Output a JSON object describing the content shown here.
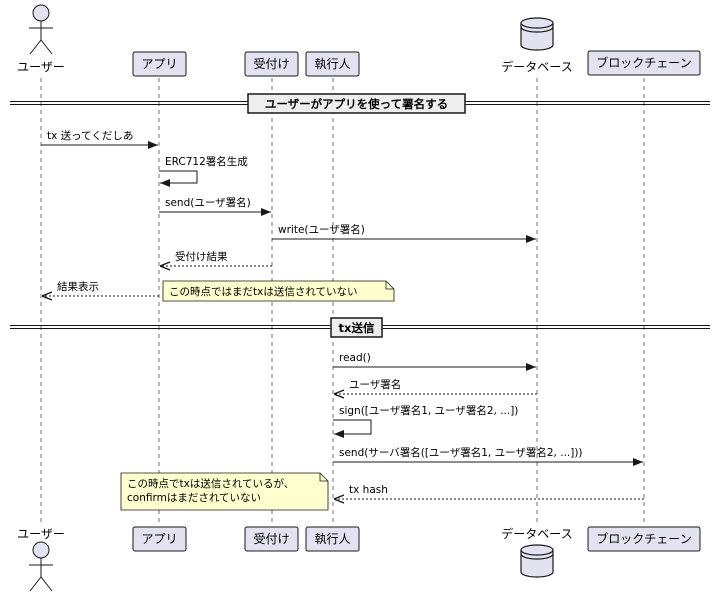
{
  "participants": [
    {
      "id": "user",
      "label": "ユーザー",
      "kind": "actor"
    },
    {
      "id": "app",
      "label": "アプリ",
      "kind": "box"
    },
    {
      "id": "recv",
      "label": "受付け",
      "kind": "box"
    },
    {
      "id": "exec",
      "label": "執行人",
      "kind": "box"
    },
    {
      "id": "db",
      "label": "データベース",
      "kind": "database"
    },
    {
      "id": "chain",
      "label": "ブロックチェーン",
      "kind": "box"
    }
  ],
  "sections": [
    {
      "title": "ユーザーがアプリを使って署名する"
    },
    {
      "title": "tx送信"
    }
  ],
  "messages": [
    {
      "from": "user",
      "to": "app",
      "label": "tx 送ってくだしあ",
      "style": "solid"
    },
    {
      "from": "app",
      "to": "app",
      "label": "ERC712署名生成",
      "style": "self"
    },
    {
      "from": "app",
      "to": "recv",
      "label": "send(ユーザ署名)",
      "style": "solid"
    },
    {
      "from": "recv",
      "to": "db",
      "label": "write(ユーザ署名)",
      "style": "solid"
    },
    {
      "from": "recv",
      "to": "app",
      "label": "受付け結果",
      "style": "dashed"
    },
    {
      "from": "app",
      "to": "user",
      "label": "結果表示",
      "style": "dashed"
    },
    {
      "from": "exec",
      "to": "db",
      "label": "read()",
      "style": "solid"
    },
    {
      "from": "db",
      "to": "exec",
      "label": "ユーザ署名",
      "style": "dashed"
    },
    {
      "from": "exec",
      "to": "exec",
      "label": "sign([ユーザ署名1, ユーザ署名2, ...])",
      "style": "self"
    },
    {
      "from": "exec",
      "to": "chain",
      "label": "send(サーバ署名([ユーザ署名1, ユーザ署名2, ...]))",
      "style": "solid"
    },
    {
      "from": "chain",
      "to": "exec",
      "label": "tx hash",
      "style": "dashed"
    }
  ],
  "notes": [
    {
      "lines": [
        "この時点ではまだtxは送信されていない"
      ]
    },
    {
      "lines": [
        "この時点でtxは送信されているが、",
        "confirmはまだされていない"
      ]
    }
  ],
  "colors": {
    "participant_fill": "#e2e2f0",
    "participant_stroke": "#181818",
    "note_fill": "#fefece",
    "separator_box_fill": "#eeeeee",
    "line": "#181818"
  }
}
